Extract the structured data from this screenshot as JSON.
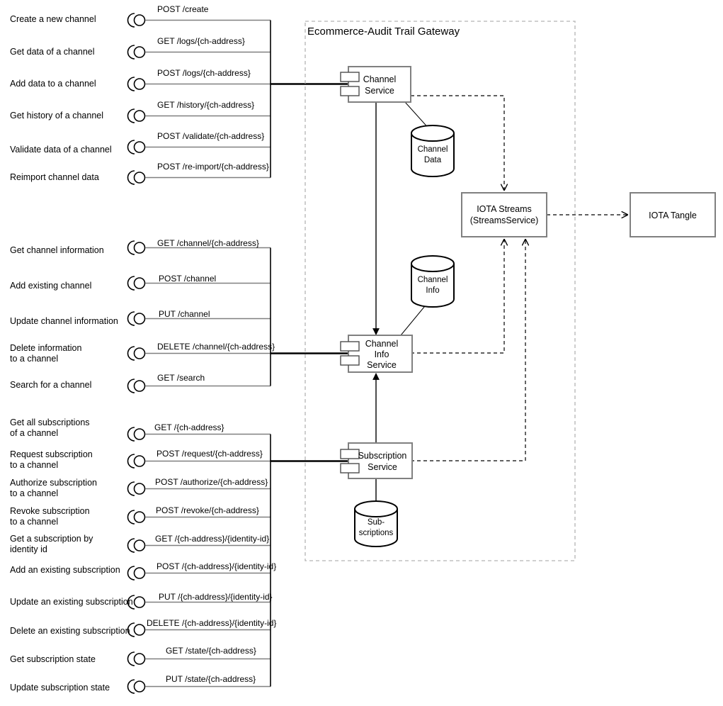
{
  "diagram": {
    "title_visible": false,
    "container": {
      "label": "Ecommerce-Audit Trail Gateway"
    },
    "colors": {
      "component_stroke": "#808080",
      "container_stroke": "#b3b3b3",
      "connector_thin": "#808080",
      "connector_thick": "#000000",
      "background": "#ffffff"
    },
    "groups": [
      {
        "id": "channel-service-api",
        "target_component": "Channel Service",
        "operations": [
          {
            "description": "Create a new channel",
            "endpoint": "POST /create"
          },
          {
            "description": "Get data of a channel",
            "endpoint": "GET /logs/{ch-address}"
          },
          {
            "description": "Add data to a channel",
            "endpoint": "POST /logs/{ch-address}"
          },
          {
            "description": "Get history of a channel",
            "endpoint": "GET /history/{ch-address}"
          },
          {
            "description": "Validate data of a channel",
            "endpoint": "POST /validate/{ch-address}"
          },
          {
            "description": "Reimport channel data",
            "endpoint": "POST /re-import/{ch-address}"
          }
        ]
      },
      {
        "id": "channel-info-service-api",
        "target_component": "Channel Info Service",
        "operations": [
          {
            "description": "Get channel information",
            "endpoint": "GET /channel/{ch-address}"
          },
          {
            "description": "Add existing channel",
            "endpoint": "POST /channel"
          },
          {
            "description": "Update channel information",
            "endpoint": "PUT /channel"
          },
          {
            "description": "Delete information\nto a channel",
            "endpoint": "DELETE /channel/{ch-address}"
          },
          {
            "description": "Search for a channel",
            "endpoint": "GET /search"
          }
        ]
      },
      {
        "id": "subscription-service-api",
        "target_component": "Subscription Service",
        "operations": [
          {
            "description": "Get all subscriptions\nof a channel",
            "endpoint": "GET /{ch-address}"
          },
          {
            "description": "Request subscription\nto a channel",
            "endpoint": "POST /request/{ch-address}"
          },
          {
            "description": "Authorize subscription\nto a channel",
            "endpoint": "POST /authorize/{ch-address}"
          },
          {
            "description": "Revoke subscription\nto a channel",
            "endpoint": "POST /revoke/{ch-address}"
          },
          {
            "description": "Get a subscription by\nidentity id",
            "endpoint": "GET /{ch-address}/{identity-id}"
          },
          {
            "description": "Add an existing subscription",
            "endpoint": "POST /{ch-address}/{identity-id}"
          },
          {
            "description": "Update an existing subscription",
            "endpoint": "PUT /{ch-address}/{identity-id}"
          },
          {
            "description": "Delete an existing subscription",
            "endpoint": "DELETE /{ch-address}/{identity-id}"
          },
          {
            "description": "Get subscription state",
            "endpoint": "GET /state/{ch-address}"
          },
          {
            "description": "Update subscription state",
            "endpoint": "PUT /state/{ch-address}"
          }
        ]
      }
    ],
    "components": [
      {
        "id": "channel-service",
        "label": "Channel\nService"
      },
      {
        "id": "channel-info-service",
        "label": "Channel\nInfo\nService"
      },
      {
        "id": "subscription-service",
        "label": "Subscription\nService"
      }
    ],
    "databases": [
      {
        "id": "channel-data",
        "label": "Channel\nData"
      },
      {
        "id": "channel-info",
        "label": "Channel\nInfo"
      },
      {
        "id": "subscriptions",
        "label": "Sub-\nscriptions"
      }
    ],
    "external_nodes": [
      {
        "id": "iota-streams",
        "label": "IOTA Streams\n(StreamsService)"
      },
      {
        "id": "iota-tangle",
        "label": "IOTA Tangle"
      }
    ]
  },
  "labels": {
    "g0_op0": "Create a new channel",
    "g0_op1": "Get data of a channel",
    "g0_op2": "Add data to a channel",
    "g0_op3": "Get history of a channel",
    "g0_op4": "Validate data of a channel",
    "g0_op5": "Reimport channel data",
    "g0_ep0": "POST /create",
    "g0_ep1": "GET /logs/{ch-address}",
    "g0_ep2": "POST /logs/{ch-address}",
    "g0_ep3": "GET /history/{ch-address}",
    "g0_ep4": "POST /validate/{ch-address}",
    "g0_ep5": "POST /re-import/{ch-address}",
    "g1_op0": "Get channel information",
    "g1_op1": "Add existing channel",
    "g1_op2": "Update channel information",
    "g1_op3a": "Delete information",
    "g1_op3b": "to a channel",
    "g1_op4": "Search for a channel",
    "g1_ep0": "GET /channel/{ch-address}",
    "g1_ep1": "POST /channel",
    "g1_ep2": "PUT /channel",
    "g1_ep3": "DELETE /channel/{ch-address}",
    "g1_ep4": "GET /search",
    "g2_op0a": "Get all subscriptions",
    "g2_op0b": "of a channel",
    "g2_op1a": "Request subscription",
    "g2_op1b": "to a channel",
    "g2_op2a": "Authorize subscription",
    "g2_op2b": "to a channel",
    "g2_op3a": "Revoke subscription",
    "g2_op3b": "to a channel",
    "g2_op4a": "Get a subscription by",
    "g2_op4b": "identity id",
    "g2_op5": "Add an existing subscription",
    "g2_op6": "Update an existing subscription",
    "g2_op7": "Delete an existing subscription",
    "g2_op8": "Get subscription state",
    "g2_op9": "Update subscription state",
    "g2_ep0": "GET /{ch-address}",
    "g2_ep1": "POST /request/{ch-address}",
    "g2_ep2": "POST /authorize/{ch-address}",
    "g2_ep3": "POST /revoke/{ch-address}",
    "g2_ep4": "GET /{ch-address}/{identity-id}",
    "g2_ep5": "POST /{ch-address}/{identity-id}",
    "g2_ep6": "PUT /{ch-address}/{identity-id}",
    "g2_ep7": "DELETE /{ch-address}/{identity-id}",
    "g2_ep8": "GET /state/{ch-address}",
    "g2_ep9": "PUT /state/{ch-address}",
    "container_title": "Ecommerce-Audit Trail Gateway",
    "comp_channel_service_l1": "Channel",
    "comp_channel_service_l2": "Service",
    "comp_channel_info_l1": "Channel",
    "comp_channel_info_l2": "Info",
    "comp_channel_info_l3": "Service",
    "comp_subscription_l1": "Subscription",
    "comp_subscription_l2": "Service",
    "db_channel_data_l1": "Channel",
    "db_channel_data_l2": "Data",
    "db_channel_info_l1": "Channel",
    "db_channel_info_l2": "Info",
    "db_subscriptions_l1": "Sub-",
    "db_subscriptions_l2": "scriptions",
    "node_streams_l1": "IOTA Streams",
    "node_streams_l2": "(StreamsService)",
    "node_tangle": "IOTA Tangle"
  }
}
